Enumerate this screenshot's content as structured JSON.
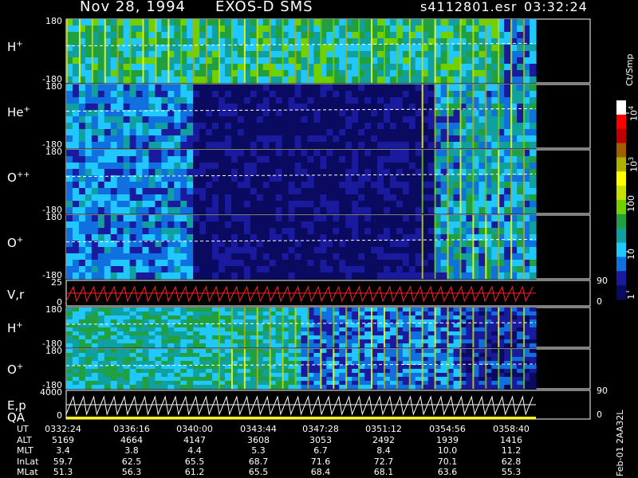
{
  "header": {
    "date": "Nov 28, 1994",
    "instrument": "EXOS-D SMS",
    "filename": "s4112801.esr",
    "time": "03:32:24"
  },
  "colorbar": {
    "unit": "Ct/Smp",
    "ticks": [
      {
        "label": "10",
        "sup": "4",
        "value": 10000
      },
      {
        "label": "10",
        "sup": "3",
        "value": 1000
      },
      {
        "label": "100",
        "sup": "",
        "value": 100
      },
      {
        "label": "10",
        "sup": "",
        "value": 10
      },
      {
        "label": "1",
        "sup": "",
        "value": 1
      }
    ],
    "colors": [
      "#ffffff",
      "#ff0000",
      "#c00000",
      "#a06000",
      "#b0b000",
      "#ffff00",
      "#c8e000",
      "#70d000",
      "#20a040",
      "#10a0a0",
      "#20c8ff",
      "#1070e0",
      "#1a1a9e",
      "#0a0a60"
    ]
  },
  "chart_data": [
    {
      "type": "heatmap",
      "panel": "H+",
      "ylabel": "H",
      "ysup": "+",
      "ylim": [
        -180,
        180
      ],
      "ytick_top": "180",
      "ytick_bottom": "-180",
      "level": "high"
    },
    {
      "type": "heatmap",
      "panel": "He+",
      "ylabel": "He",
      "ysup": "+",
      "ylim": [
        -180,
        180
      ],
      "ytick_top": "180",
      "ytick_bottom": "-180",
      "level": "low"
    },
    {
      "type": "heatmap",
      "panel": "O++",
      "ylabel": "O",
      "ysup": "++",
      "ylim": [
        -180,
        180
      ],
      "ytick_top": "180",
      "ytick_bottom": "-180",
      "level": "low"
    },
    {
      "type": "heatmap",
      "panel": "O+",
      "ylabel": "O",
      "ysup": "+",
      "ylim": [
        -180,
        180
      ],
      "ytick_top": "180",
      "ytick_bottom": "-180",
      "level": "low"
    },
    {
      "type": "line",
      "panel": "V,r",
      "ylabel": "V,r",
      "ylim": [
        0,
        25
      ],
      "ytick_top": "25",
      "ytick_bottom": "0",
      "right_top": "90",
      "right_bottom": "0"
    },
    {
      "type": "heatmap",
      "panel": "H+ (2)",
      "ylabel": "H",
      "ysup": "+",
      "ylim": [
        -180,
        180
      ],
      "ytick_top": "180",
      "ytick_bottom": "-180",
      "level": "mid"
    },
    {
      "type": "heatmap",
      "panel": "O+ (2)",
      "ylabel": "O",
      "ysup": "+",
      "ylim": [
        -180,
        180
      ],
      "ytick_top": "180",
      "ytick_bottom": "-180",
      "level": "mid"
    },
    {
      "type": "line",
      "panel": "E,p QA",
      "ylabel": "E,p",
      "ylabel2": "QA",
      "ylim": [
        0,
        4000
      ],
      "ytick_top": "4000",
      "ytick_bottom": "0",
      "right_top": "90",
      "right_bottom": "0"
    }
  ],
  "table": {
    "rows": [
      {
        "label": "UT",
        "values": [
          "0332:24",
          "0336:16",
          "0340:00",
          "0343:44",
          "0347:28",
          "0351:12",
          "0354:56",
          "0358:40"
        ]
      },
      {
        "label": "ALT",
        "values": [
          "5169",
          "4664",
          "4147",
          "3608",
          "3053",
          "2492",
          "1939",
          "1416"
        ]
      },
      {
        "label": "MLT",
        "values": [
          "3.4",
          "3.8",
          "4.4",
          "5.3",
          "6.7",
          "8.4",
          "10.0",
          "11.2"
        ]
      },
      {
        "label": "InLat",
        "values": [
          "59.7",
          "62.5",
          "65.5",
          "68.7",
          "71.6",
          "72.7",
          "70.1",
          "62.8"
        ]
      },
      {
        "label": "MLat",
        "values": [
          "51.3",
          "56.3",
          "61.2",
          "65.5",
          "68.4",
          "68.1",
          "63.6",
          "55.3"
        ]
      }
    ]
  },
  "footer_code": "Feb-01 2AA32L"
}
